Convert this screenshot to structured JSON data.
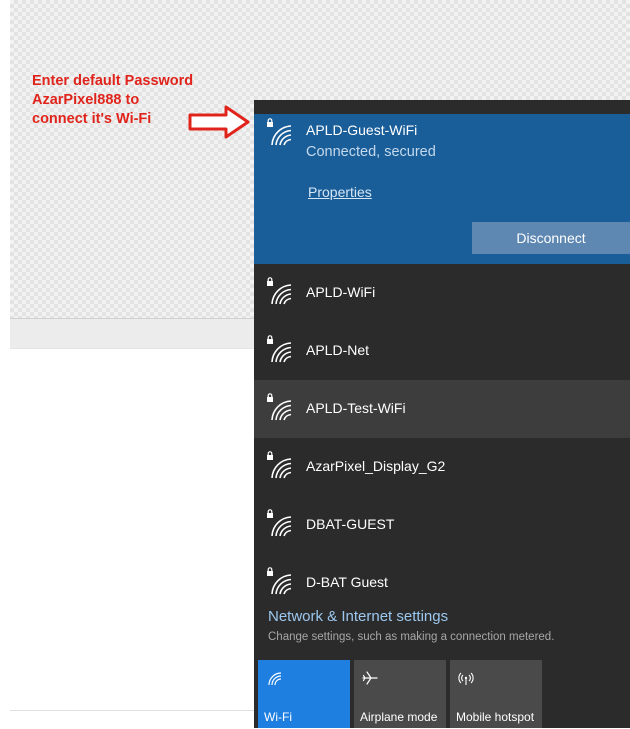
{
  "annotation": {
    "lines": [
      "Enter default Password",
      "AzarPixel888 to",
      "connect it's Wi-Fi"
    ]
  },
  "connected_network": {
    "name": "APLD-Guest-WiFi",
    "status": "Connected, secured",
    "properties_label": "Properties",
    "disconnect_label": "Disconnect"
  },
  "networks": [
    {
      "name": "APLD-WiFi"
    },
    {
      "name": "APLD-Net"
    },
    {
      "name": "APLD-Test-WiFi"
    },
    {
      "name": "AzarPixel_Display_G2"
    },
    {
      "name": "DBAT-GUEST"
    },
    {
      "name": "D-BAT Guest"
    }
  ],
  "settings": {
    "link": "Network & Internet settings",
    "description": "Change settings, such as making a connection metered."
  },
  "quick_actions": [
    {
      "label": "Wi-Fi",
      "icon": "wifi-icon",
      "active": true
    },
    {
      "label": "Airplane mode",
      "icon": "airplane-icon",
      "active": false
    },
    {
      "label": "Mobile hotspot",
      "icon": "hotspot-icon",
      "active": false
    }
  ],
  "colors": {
    "annotation": "#e0241b",
    "connected_bg": "#1a5e99",
    "flyout_bg": "#2b2b2b",
    "wifi_tile_active": "#1e7fe0",
    "settings_link": "#9cc8f0"
  }
}
